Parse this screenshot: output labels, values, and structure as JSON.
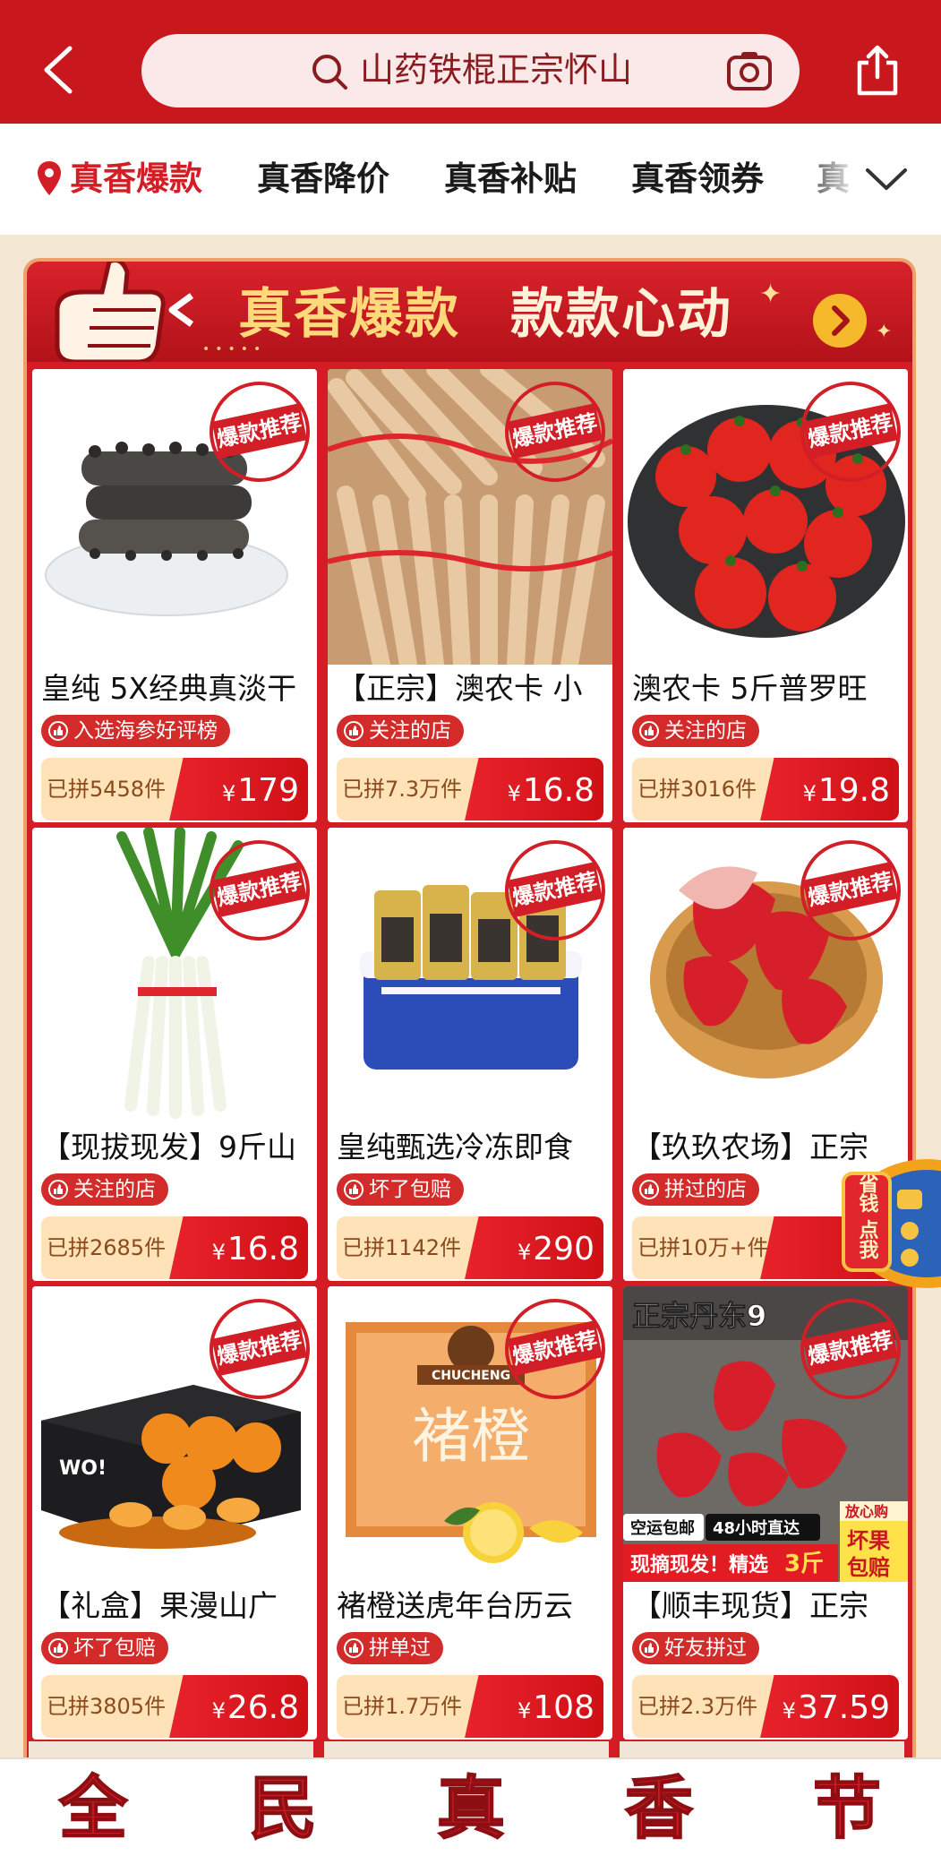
{
  "header": {
    "search_text": "山药铁棍正宗怀山",
    "back_icon": "chevron-left-icon",
    "camera_icon": "camera-icon",
    "share_icon": "share-icon"
  },
  "tabs": [
    {
      "label": "真香爆款",
      "active": true
    },
    {
      "label": "真香降价"
    },
    {
      "label": "真香补贴"
    },
    {
      "label": "真香领券"
    },
    {
      "label": "真"
    }
  ],
  "banner": {
    "title1": "真香爆款",
    "title2": "款款心动",
    "dots": "•••••"
  },
  "stamp_label": "爆款推荐",
  "products": [
    {
      "title": "皇纯 5X经典真淡干",
      "tag": "入选海参好评榜",
      "sold": "已拼5458件",
      "yen": "¥",
      "price": "179"
    },
    {
      "title": "【正宗】澳农卡 小",
      "tag": "关注的店",
      "sold": "已拼7.3万件",
      "yen": "¥",
      "price": "16.8"
    },
    {
      "title": "澳农卡 5斤普罗旺",
      "tag": "关注的店",
      "sold": "已拼3016件",
      "yen": "¥",
      "price": "19.8"
    },
    {
      "title": "【现拔现发】9斤山",
      "tag": "关注的店",
      "sold": "已拼2685件",
      "yen": "¥",
      "price": "16.8"
    },
    {
      "title": "皇纯甄选冷冻即食",
      "tag": "坏了包赔",
      "sold": "已拼1142件",
      "yen": "¥",
      "price": "290"
    },
    {
      "title": "【玖玖农场】正宗",
      "tag": "拼过的店",
      "sold": "已拼10万+件",
      "yen": "¥",
      "price": ""
    },
    {
      "title": "【礼盒】果漫山广",
      "tag": "坏了包赔",
      "sold": "已拼3805件",
      "yen": "¥",
      "price": "26.8"
    },
    {
      "title": "褚橙送虎年台历云",
      "tag": "拼单过",
      "sold": "已拼1.7万件",
      "yen": "¥",
      "price": "108"
    },
    {
      "title": "【顺丰现货】正宗",
      "tag": "好友拼过",
      "sold": "已拼2.3万件",
      "yen": "¥",
      "price": "37.59"
    }
  ],
  "thumb_overlay": {
    "strawberry_top": "正宗丹东9",
    "badge_ship": "空运包邮",
    "badge_48h": "48小时直达",
    "badge_pick": "现摘现发！精选",
    "badge_3jin": "3斤",
    "badge_safe": "放心购",
    "badge_bad": "坏果",
    "badge_pay": "包赔",
    "chucheng_brand": "CHUCHENG",
    "chucheng_name": "褚橙",
    "box_text": "WO!"
  },
  "floating": {
    "label": "省钱 点我"
  },
  "bottom_nav": [
    {
      "char": "全",
      "sub": ""
    },
    {
      "char": "民",
      "sub": ""
    },
    {
      "char": "真",
      "sub": ""
    },
    {
      "char": "香",
      "sub": ""
    },
    {
      "char": "节",
      "sub": ""
    }
  ],
  "colors": {
    "brand_red": "#c8171d",
    "accent_gold": "#ffd97a",
    "price_bg": "#ffe2b7"
  }
}
